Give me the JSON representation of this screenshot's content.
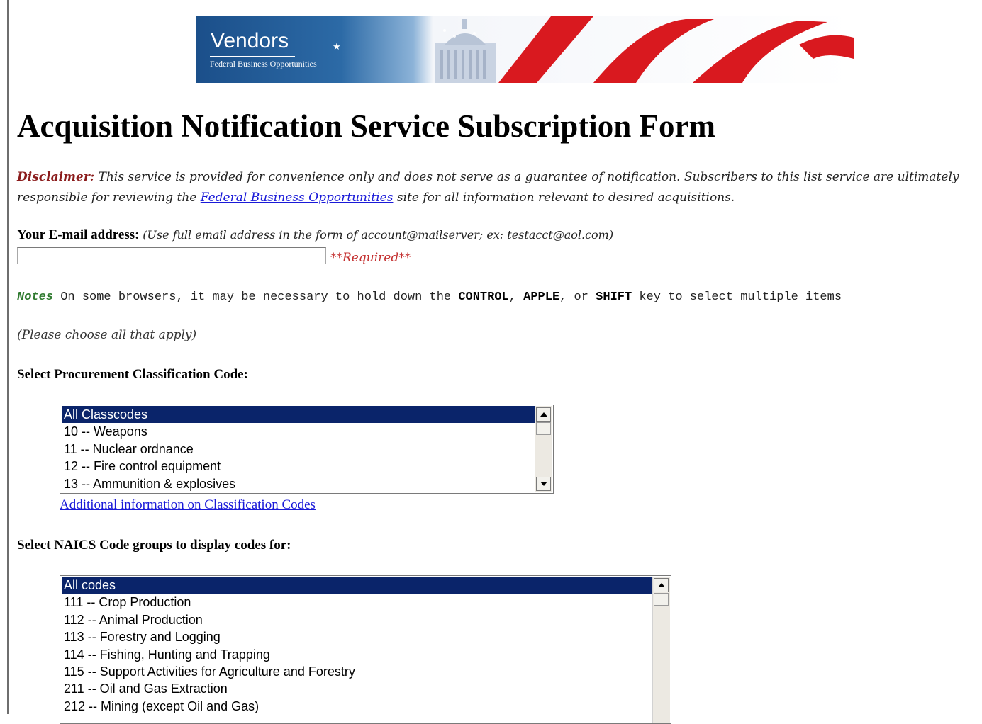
{
  "banner": {
    "title": "Vendors",
    "subtitle": "Federal Business Opportunities",
    "star": "★",
    "colors": {
      "blue": "#1b4f8a",
      "stripe_red": "#d9191f"
    }
  },
  "page_title": "Acquisition Notification Service Subscription Form",
  "disclaimer": {
    "lead": "Disclaimer:",
    "text_before_link": "This service is provided for convenience only and does not serve as a guarantee of notification. Subscribers to this list service are ultimately responsible for reviewing the",
    "link_text": "Federal Business Opportunities",
    "text_after_link": "site for all information relevant to desired acquisitions."
  },
  "email": {
    "label": "Your E-mail address:",
    "hint": "(Use full email address in the form of account@mailserver; ex: testacct@aol.com)",
    "value": "",
    "required": "**Required**"
  },
  "notes": {
    "label": "Notes",
    "text_1": "On some browsers, it may be necessary to hold down the",
    "key_control": "CONTROL",
    "sep_1": ",",
    "key_apple": "APPLE",
    "sep_2": ", or",
    "key_shift": "SHIFT",
    "text_2": "key to select multiple items"
  },
  "choose_text": "(Please choose all that apply)",
  "classification": {
    "label": "Select Procurement Classification Code:",
    "options": [
      "All Classcodes",
      "10 -- Weapons",
      "11 -- Nuclear ordnance",
      "12 -- Fire control equipment",
      "13 -- Ammunition & explosives"
    ],
    "selected": "All Classcodes",
    "info_link": "Additional information on Classification Codes"
  },
  "naics": {
    "label": "Select NAICS Code groups to display codes for:",
    "options": [
      "All codes",
      "111 -- Crop Production",
      "112 -- Animal Production",
      "113 -- Forestry and Logging",
      "114 -- Fishing, Hunting and Trapping",
      "115 -- Support Activities for Agriculture and Forestry",
      "211 -- Oil and Gas Extraction",
      "212 -- Mining (except Oil and Gas)"
    ],
    "selected": "All codes"
  },
  "colors": {
    "listbox_selected": "#0a246a",
    "link": "#1a1ad8",
    "disclaimer_lead": "#8b1c1c",
    "required": "#c43030",
    "notes_label": "#2f7a2f"
  }
}
